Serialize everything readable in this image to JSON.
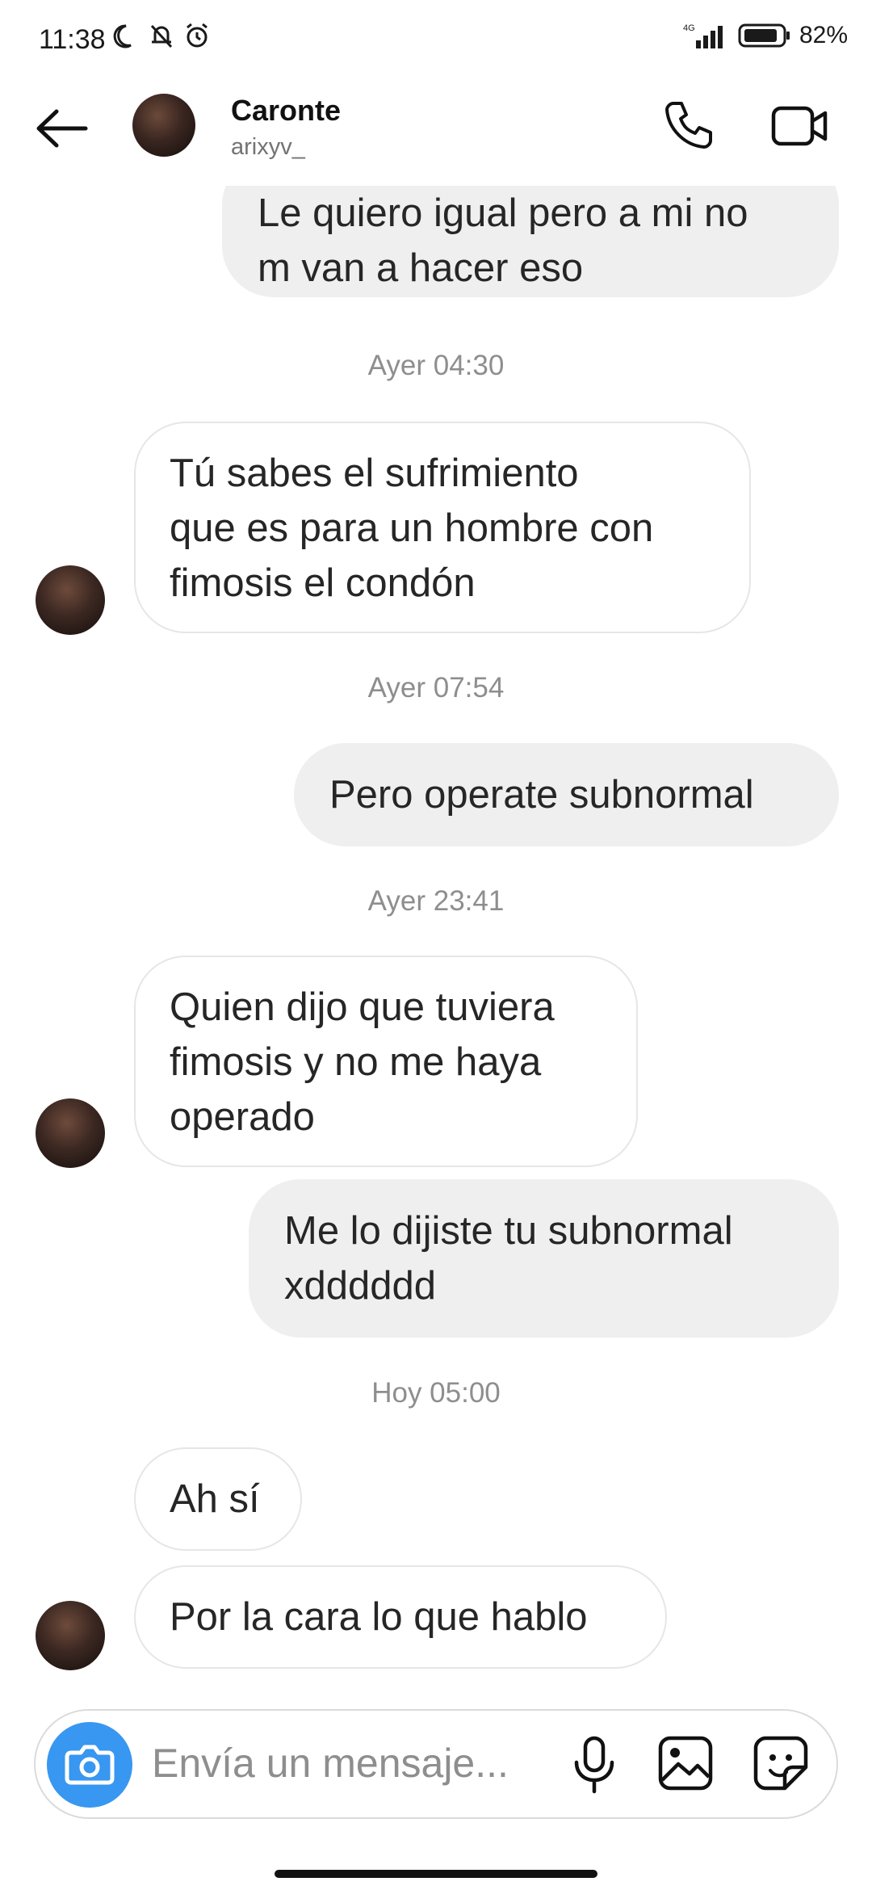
{
  "status_bar": {
    "time": "11:38",
    "network": "4G",
    "battery": "82%"
  },
  "header": {
    "name": "Caronte",
    "username": "arixyv_",
    "icons": [
      "back-arrow-icon",
      "phone-icon",
      "video-call-icon"
    ]
  },
  "messages": [
    {
      "type": "out",
      "text_lines": [
        "Le quiero igual pero a mi no",
        "m van a hacer eso"
      ]
    },
    {
      "type": "timestamp",
      "text": "Ayer 04:30"
    },
    {
      "type": "in",
      "text_lines": [
        "Tú sabes el sufrimiento",
        "que es para un hombre con",
        "fimosis el condón"
      ]
    },
    {
      "type": "timestamp",
      "text": "Ayer 07:54"
    },
    {
      "type": "out",
      "text_lines": [
        "Pero operate subnormal"
      ]
    },
    {
      "type": "timestamp",
      "text": "Ayer 23:41"
    },
    {
      "type": "in",
      "text_lines": [
        "Quien dijo que tuviera",
        "fimosis y no me haya",
        "operado"
      ]
    },
    {
      "type": "out",
      "text_lines": [
        "Me lo dijiste tu subnormal",
        "xdddddd"
      ]
    },
    {
      "type": "timestamp",
      "text": "Hoy 05:00"
    },
    {
      "type": "in",
      "text_lines": [
        "Ah sí"
      ]
    },
    {
      "type": "in",
      "text_lines": [
        "Por la cara lo que hablo"
      ]
    }
  ],
  "composer": {
    "placeholder": "Envía un mensaje...",
    "icons": [
      "camera-icon",
      "microphone-icon",
      "gallery-icon",
      "sticker-icon"
    ]
  },
  "colors": {
    "accent": "#3897f0",
    "outgoing_bubble": "#efefef",
    "incoming_border": "#e6e6e6",
    "muted_text": "#8e8e8e"
  }
}
